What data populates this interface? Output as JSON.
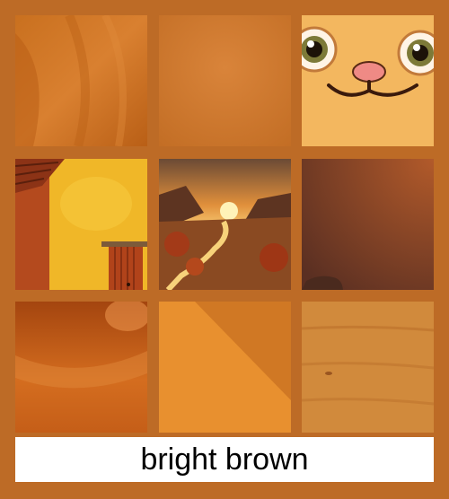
{
  "caption": "bright brown",
  "palette": {
    "background": "#bd6b26",
    "caption_bg": "#ffffff",
    "caption_text": "#000000"
  },
  "tiles": [
    {
      "name": "fabric-fold",
      "icon": "folded-cloth"
    },
    {
      "name": "paper-texture",
      "icon": "parchment"
    },
    {
      "name": "cartoon-face",
      "icon": "smiling-animal-face"
    },
    {
      "name": "yellow-barn-wall",
      "icon": "barn-door"
    },
    {
      "name": "sunset-valley",
      "icon": "river-landscape"
    },
    {
      "name": "dusk-gradient",
      "icon": "rock-silhouette"
    },
    {
      "name": "glossy-surface",
      "icon": "gradient"
    },
    {
      "name": "diagonal-gradient",
      "icon": "gradient"
    },
    {
      "name": "wood-grain",
      "icon": "wood-texture"
    }
  ]
}
